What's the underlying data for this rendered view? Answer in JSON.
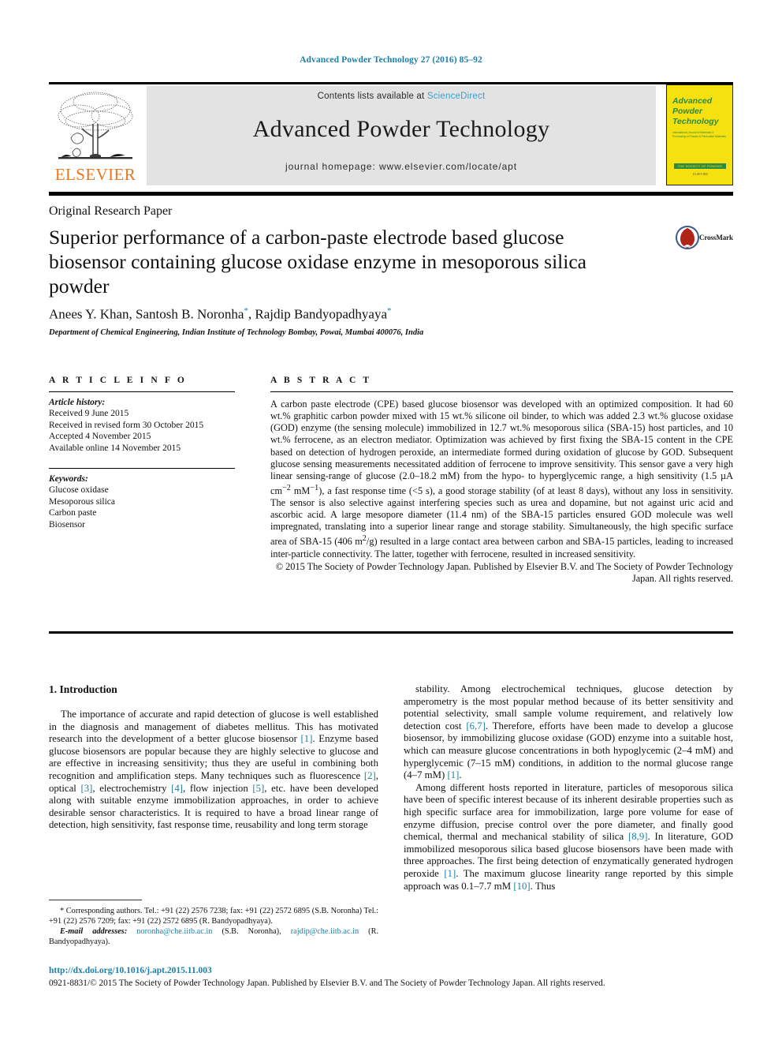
{
  "running_head": "Advanced Powder Technology 27 (2016) 85–92",
  "header": {
    "contents_prefix": "Contents lists available at ",
    "sciencedirect": "ScienceDirect",
    "journal_title": "Advanced Powder Technology",
    "homepage": "journal homepage: www.elsevier.com/locate/apt",
    "publisher_logo_text": "ELSEVIER",
    "cover": {
      "title": "Advanced Powder Technology",
      "subtitle": "International Journal of Materials & Processing of Powder & Particulate Materials",
      "bar_text": "THE SOCIETY OF POWDER TECHNOLOGY JAPAN",
      "mark": "ELSEVIER"
    }
  },
  "article": {
    "type": "Original Research Paper",
    "title": "Superior performance of a carbon-paste electrode based glucose biosensor containing glucose oxidase enzyme in mesoporous silica powder",
    "authors_plain": "Anees Y. Khan, Santosh B. Noronha",
    "authors_part2": ", Rajdip Bandyopadhyaya",
    "affiliation": "Department of Chemical Engineering, Indian Institute of Technology Bombay, Powai, Mumbai 400076, India",
    "crossmark_label": "CrossMark"
  },
  "info": {
    "kicker": "A R T I C L E   I N F O",
    "history_head": "Article history:",
    "history": [
      "Received 9 June 2015",
      "Received in revised form 30 October 2015",
      "Accepted 4 November 2015",
      "Available online 14 November 2015"
    ],
    "keywords_head": "Keywords:",
    "keywords": [
      "Glucose oxidase",
      "Mesoporous silica",
      "Carbon paste",
      "Biosensor"
    ]
  },
  "abstract": {
    "kicker": "A B S T R A C T",
    "body": "A carbon paste electrode (CPE) based glucose biosensor was developed with an optimized composition. It had 60 wt.% graphitic carbon powder mixed with 15 wt.% silicone oil binder, to which was added 2.3 wt.% glucose oxidase (GOD) enzyme (the sensing molecule) immobilized in 12.7 wt.% mesoporous silica (SBA-15) host particles, and 10 wt.% ferrocene, as an electron mediator. Optimization was achieved by first fixing the SBA-15 content in the CPE based on detection of hydrogen peroxide, an intermediate formed during oxidation of glucose by GOD. Subsequent glucose sensing measurements necessitated addition of ferrocene to improve sensitivity. This sensor gave a very high linear sensing-range of glucose (2.0–18.2 mM) from the hypo- to hyperglycemic range, a high sensitivity (1.5 µA cm−2 mM−1), a fast response time (<5 s), a good storage stability (of at least 8 days), without any loss in sensitivity. The sensor is also selective against interfering species such as urea and dopamine, but not against uric acid and ascorbic acid. A large mesopore diameter (11.4 nm) of the SBA-15 particles ensured GOD molecule was well impregnated, translating into a superior linear range and storage stability. Simultaneously, the high specific surface area of SBA-15 (406 m2/g) resulted in a large contact area between carbon and SBA-15 particles, leading to increased inter-particle connectivity. The latter, together with ferrocene, resulted in increased sensitivity.",
    "copyright": "© 2015 The Society of Powder Technology Japan. Published by Elsevier B.V. and The Society of Powder Technology Japan. All rights reserved."
  },
  "body": {
    "section_heading": "1. Introduction",
    "left_paragraph": "The importance of accurate and rapid detection of glucose is well established in the diagnosis and management of diabetes mellitus. This has motivated research into the development of a better glucose biosensor [1]. Enzyme based glucose biosensors are popular because they are highly selective to glucose and are effective in increasing sensitivity; thus they are useful in combining both recognition and amplification steps. Many techniques such as fluorescence [2], optical [3], electrochemistry [4], flow injection [5], etc. have been developed along with suitable enzyme immobilization approaches, in order to achieve desirable sensor characteristics. It is required to have a broad linear range of detection, high sensitivity, fast response time, reusability and long term storage",
    "right_paragraph_1": "stability. Among electrochemical techniques, glucose detection by amperometry is the most popular method because of its better sensitivity and potential selectivity, small sample volume requirement, and relatively low detection cost [6,7]. Therefore, efforts have been made to develop a glucose biosensor, by immobilizing glucose oxidase (GOD) enzyme into a suitable host, which can measure glucose concentrations in both hypoglycemic (2–4 mM) and hyperglycemic (7–15 mM) conditions, in addition to the normal glucose range (4–7 mM) [1].",
    "right_paragraph_2": "Among different hosts reported in literature, particles of mesoporous silica have been of specific interest because of its inherent desirable properties such as high specific surface area for immobilization, large pore volume for ease of enzyme diffusion, precise control over the pore diameter, and finally good chemical, thermal and mechanical stability of silica [8,9]. In literature, GOD immobilized mesoporous silica based glucose biosensors have been made with three approaches. The first being detection of enzymatically generated hydrogen peroxide [1]. The maximum glucose linearity range reported by this simple approach was 0.1–7.7 mM [10]. Thus"
  },
  "footnote": {
    "corresponding": "* Corresponding authors. Tel.: +91 (22) 2576 7238; fax: +91 (22) 2572 6895 (S.B. Noronha) Tel.: +91 (22) 2576 7209; fax: +91 (22) 2572 6895 (R. Bandyopadhyaya).",
    "email_label": "E-mail addresses:",
    "email_1": "noronha@che.iitb.ac.in",
    "email_1_owner": "(S.B. Noronha)",
    "email_2": "rajdip@che.iitb.ac.in",
    "email_2_owner": "(R. Bandyopadhyaya)."
  },
  "footer": {
    "doi": "http://dx.doi.org/10.1016/j.apt.2015.11.003",
    "issn_line": "0921-8831/© 2015 The Society of Powder Technology Japan. Published by Elsevier B.V. and The Society of Powder Technology Japan. All rights reserved."
  },
  "colors": {
    "link": "#1a7fa8",
    "sciencedirect": "#3a9fd0",
    "elsevier_orange": "#e87722",
    "cover_yellow": "#f5e010",
    "cover_green": "#2e8b40"
  }
}
